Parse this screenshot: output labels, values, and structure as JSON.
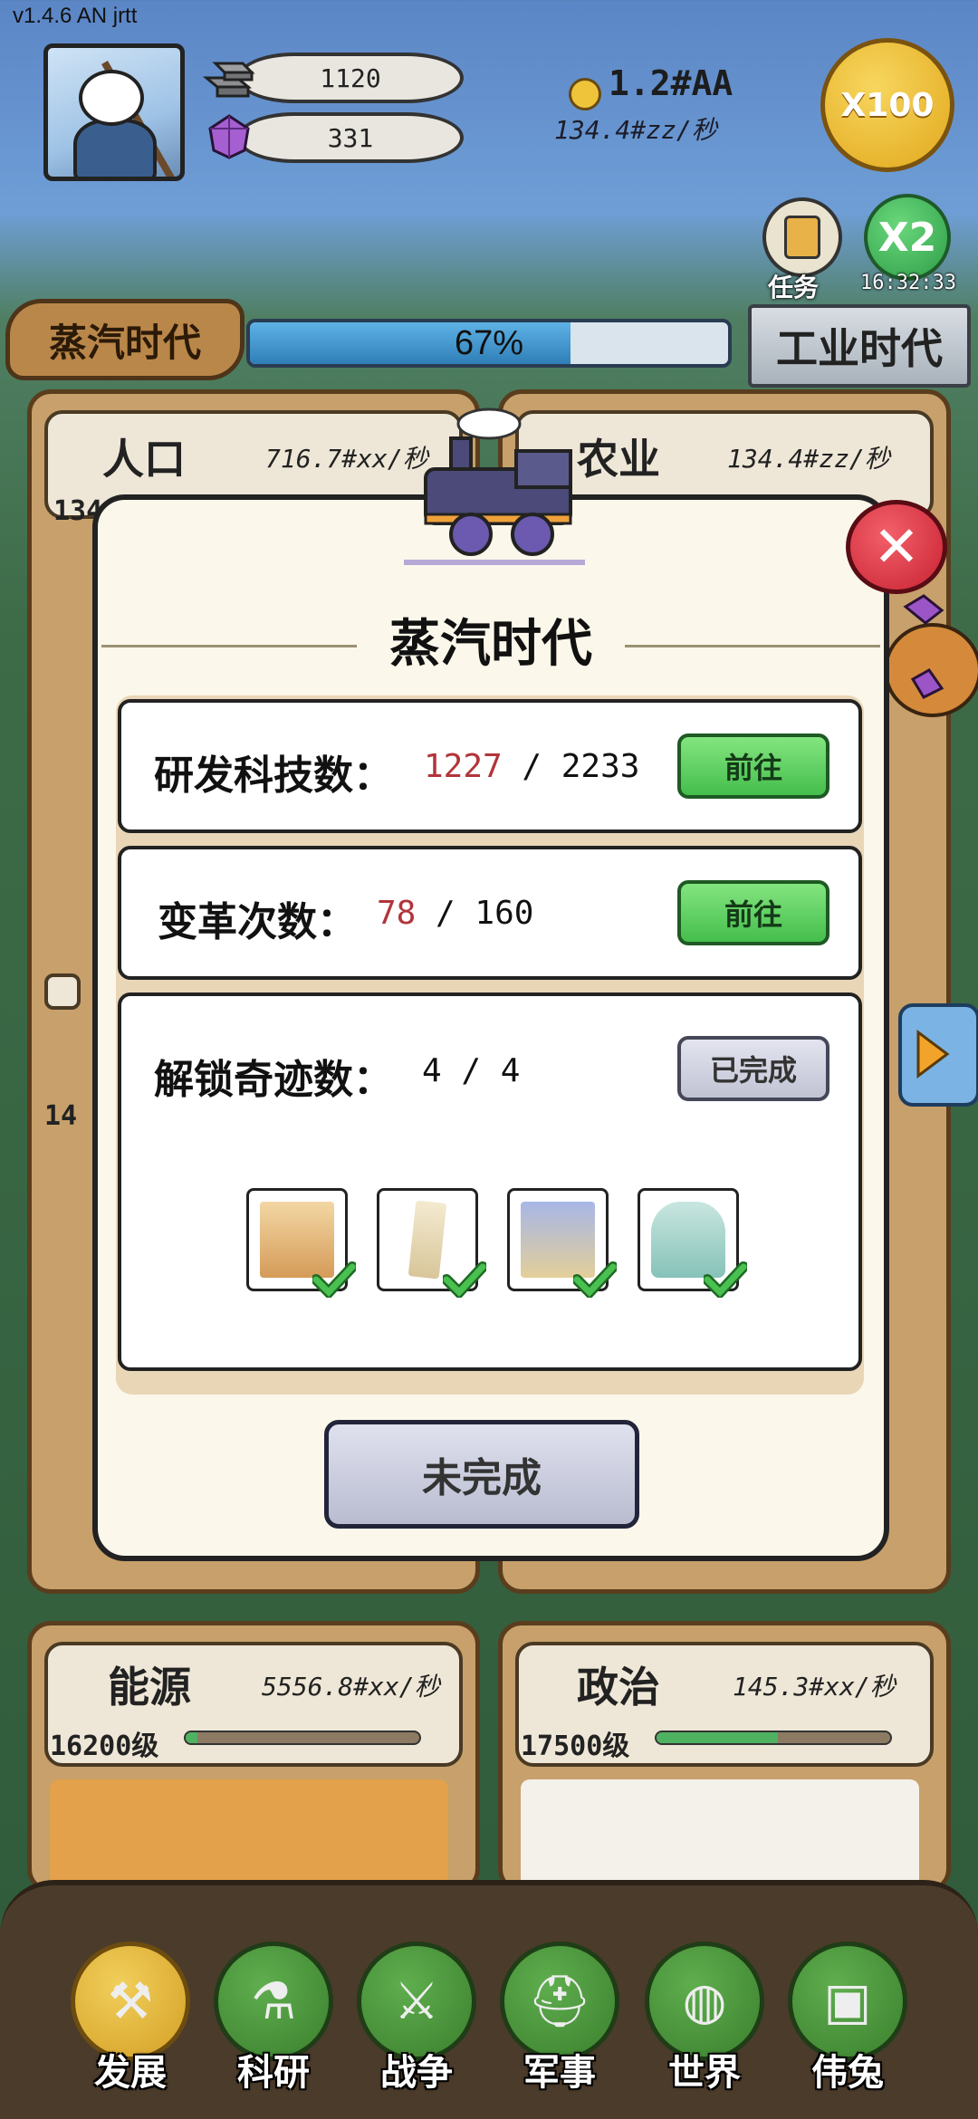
{
  "version": "v1.4.6 AN jrtt",
  "resources": {
    "ingot_amount": "1120",
    "gem_amount": "331",
    "gold_amount": "1.2#AA",
    "gold_rate": "134.4#zz/秒"
  },
  "buttons": {
    "x100": "X100",
    "task_label": "任务",
    "x2": "X2",
    "x2_timer": "16:32:33"
  },
  "era": {
    "current": "蒸汽时代",
    "progress_percent": 67,
    "progress_text": "67%",
    "next": "工业时代"
  },
  "cards": [
    {
      "title": "人口",
      "rate": "716.7#xx/秒",
      "level": "13400级"
    },
    {
      "title": "农业",
      "rate": "134.4#zz/秒",
      "level": ""
    },
    {
      "title": "能源",
      "rate": "5556.8#xx/秒",
      "level": "16200级",
      "progress": 0.05
    },
    {
      "title": "政治",
      "rate": "145.3#xx/秒",
      "level": "17500级",
      "progress": 0.52
    }
  ],
  "partial_level": "14",
  "modal": {
    "title": "蒸汽时代",
    "tasks": [
      {
        "label": "研发科技数：",
        "current": "1227",
        "sep": " / ",
        "target": "2233",
        "button": "前往"
      },
      {
        "label": "变革次数：",
        "current": "78",
        "sep": " / ",
        "target": "160",
        "button": "前往"
      },
      {
        "label": "解锁奇迹数：",
        "current": "4",
        "sep": " / ",
        "target": "4",
        "button": "已完成"
      }
    ],
    "wonders": [
      "petra-icon",
      "leaning-tower-icon",
      "tower-bridge-icon",
      "statue-of-liberty-icon"
    ],
    "status_button": "未完成"
  },
  "nav": [
    {
      "label": "发展",
      "icon": "hammer-icon",
      "active": true
    },
    {
      "label": "科研",
      "icon": "flask-icon",
      "active": false
    },
    {
      "label": "战争",
      "icon": "crossed-swords-icon",
      "active": false
    },
    {
      "label": "军事",
      "icon": "helmet-icon",
      "active": false
    },
    {
      "label": "世界",
      "icon": "globe-icon",
      "active": false
    },
    {
      "label": "伟兔",
      "icon": "portrait-icon",
      "active": false
    }
  ],
  "colors": {
    "accent_green": "#45be4d",
    "current_value_red": "#b2343b",
    "close_red": "#c92232",
    "progress_blue": "#2f7fb8",
    "gold": "#e2a81c"
  }
}
